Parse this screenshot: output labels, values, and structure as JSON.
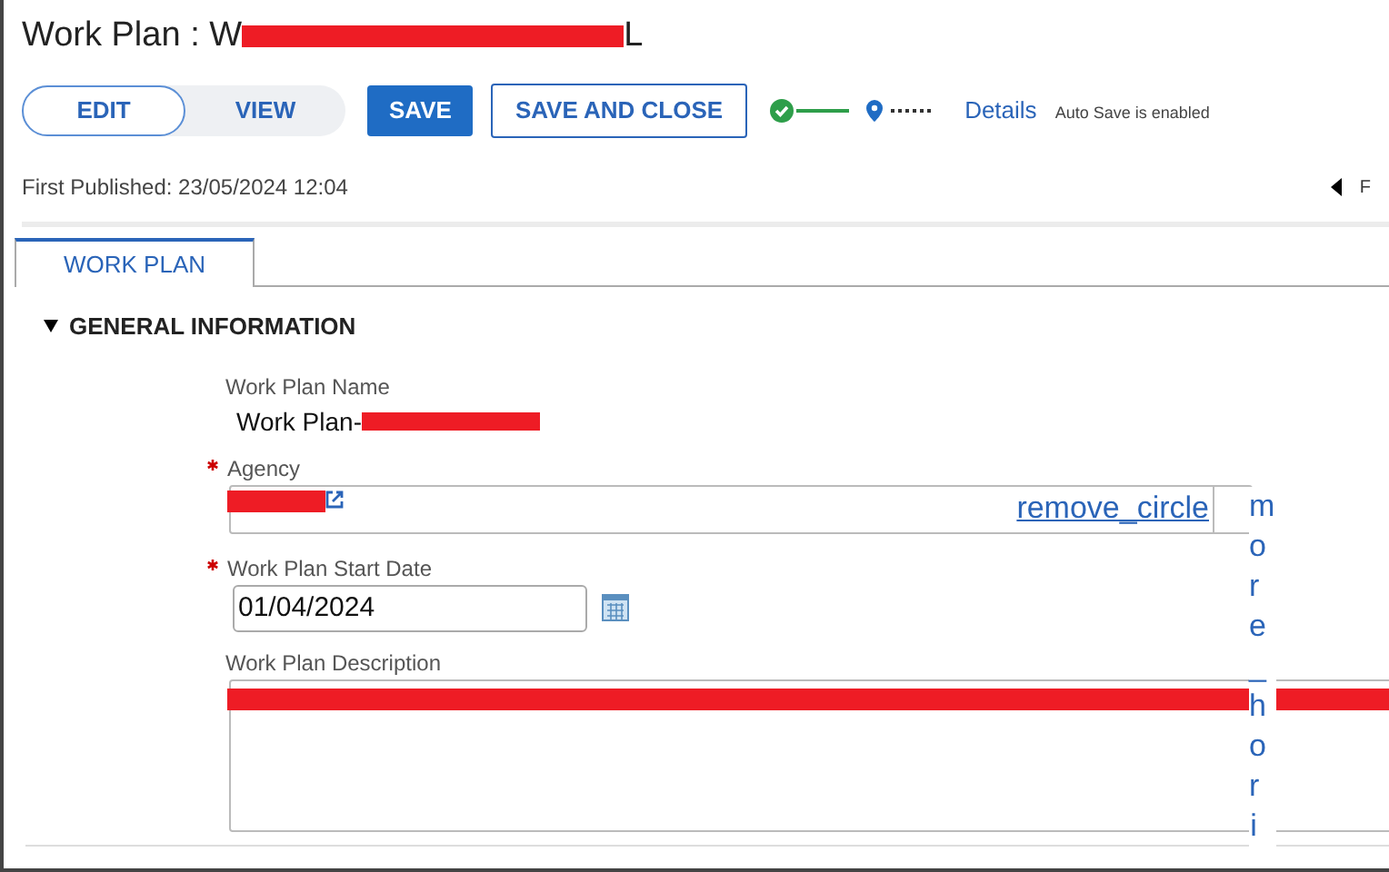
{
  "title": {
    "prefix": "Work Plan : ",
    "first_letter": "W",
    "last_letter": "L"
  },
  "toggle": [
    {
      "label": "EDIT",
      "selected": true
    },
    {
      "label": "VIEW",
      "selected": false
    }
  ],
  "buttons": [
    {
      "label": "SAVE",
      "kind": "primary"
    },
    {
      "label": "SAVE AND CLOSE",
      "kind": "outline"
    }
  ],
  "progress": {
    "details_link": "Details",
    "autosave": "Auto Save is enabled"
  },
  "first_published": "First Published: 23/05/2024 12:04",
  "nav_letter": "F",
  "tabs": [
    {
      "label": "WORK PLAN",
      "selected": true
    }
  ],
  "section": {
    "title": "GENERAL INFORMATION",
    "expanded": true
  },
  "fields": {
    "name_label": "Work Plan Name",
    "name_value": "Work Plan-",
    "agency_label": "Agency",
    "agency_required": true,
    "agency_remove": "remove_circle",
    "agency_more": "more_hori",
    "start_label": "Work Plan Start Date",
    "start_required": true,
    "start_value": "01/04/2024",
    "desc_label": "Work Plan Description"
  }
}
